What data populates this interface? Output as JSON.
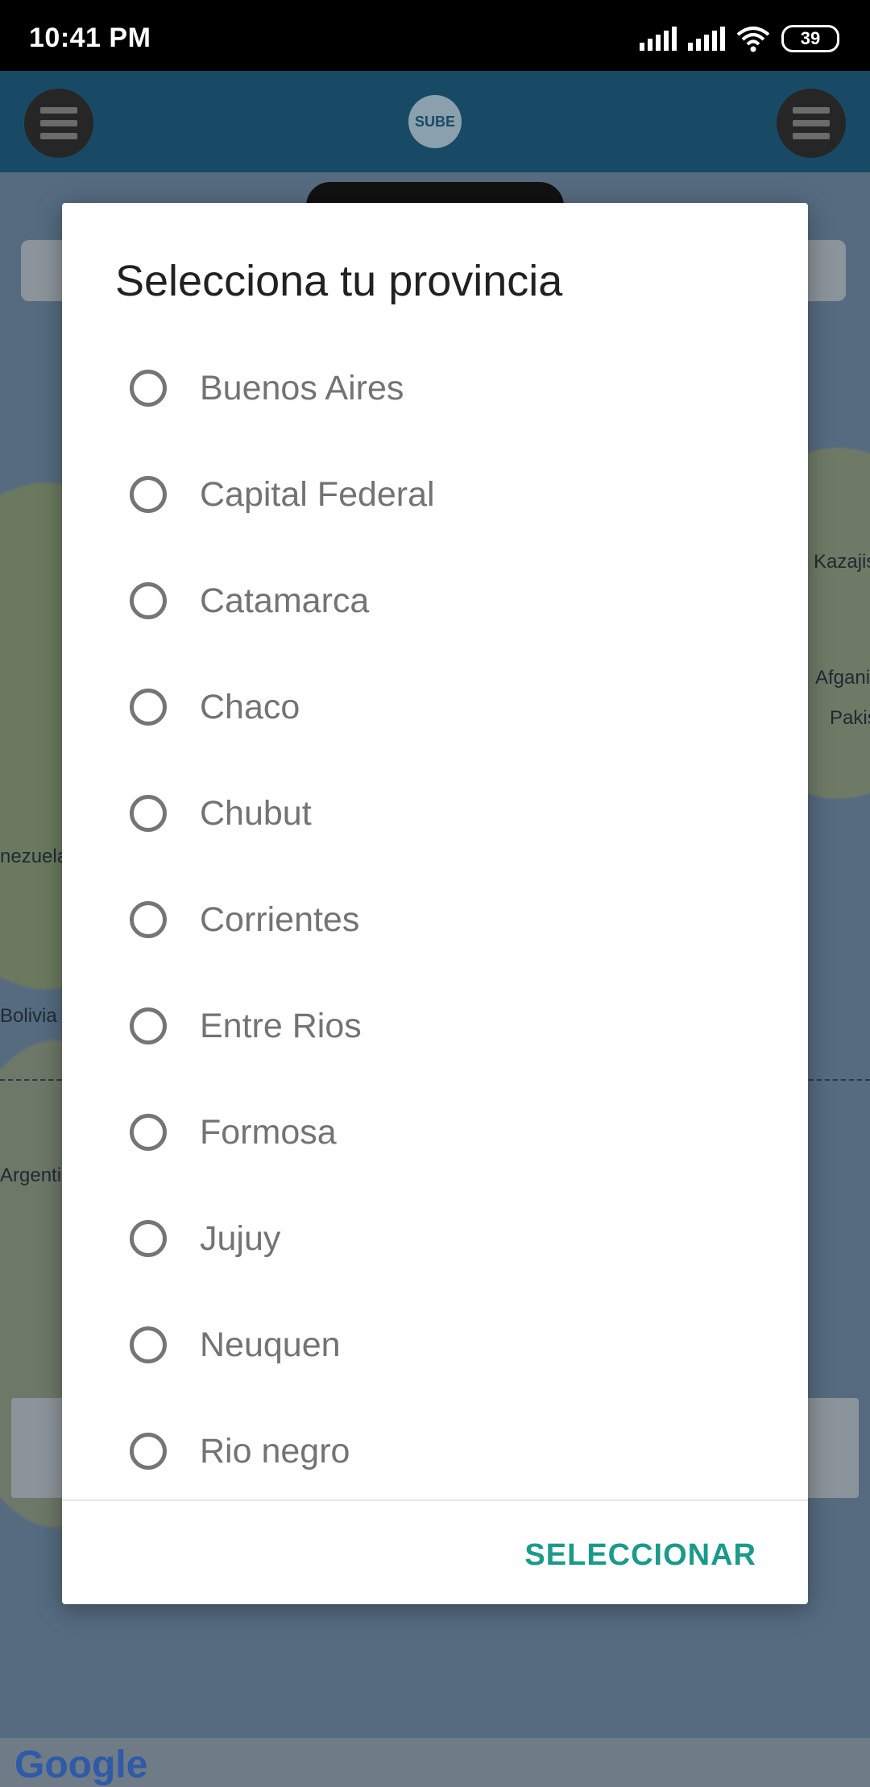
{
  "status_bar": {
    "time": "10:41 PM",
    "battery": "39",
    "icons": [
      "signal-icon",
      "signal-icon",
      "wifi-icon",
      "battery-icon"
    ]
  },
  "app_bar": {
    "logo_text": "SUBE"
  },
  "map": {
    "labels": [
      "Kazajis",
      "Afgani",
      "Pakis",
      "nezuela",
      "Bolivia",
      "Argenti",
      "Google"
    ]
  },
  "dialog": {
    "title": "Selecciona tu provincia",
    "options": [
      "Buenos Aires",
      "Capital Federal",
      "Catamarca",
      "Chaco",
      "Chubut",
      "Corrientes",
      "Entre Rios",
      "Formosa",
      "Jujuy",
      "Neuquen",
      "Rio negro"
    ],
    "action_label": "SELECCIONAR"
  },
  "colors": {
    "accent": "#1b9a8a",
    "appbar": "#184a66"
  }
}
